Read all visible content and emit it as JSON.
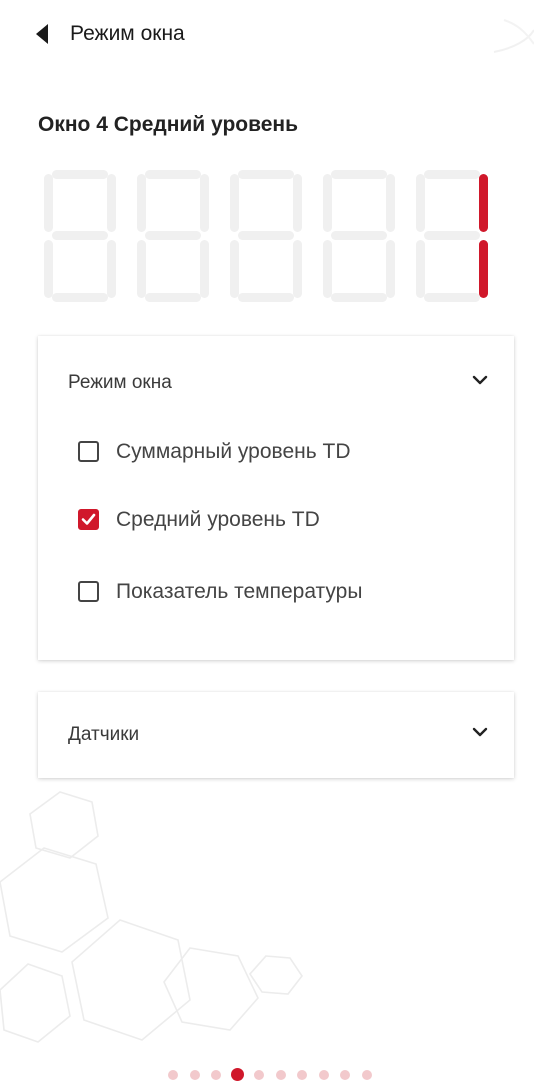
{
  "header": {
    "back_label": "Режим окна"
  },
  "window_title": "Окно 4 Средний уровень",
  "display": {
    "segment_off_color": "#f0f0f0",
    "segment_on_color": "#d0182b",
    "digits_shown": [
      "",
      "",
      "",
      "",
      "1"
    ]
  },
  "mode_panel": {
    "title": "Режим окна",
    "options": [
      {
        "label": "Суммарный уровень TD",
        "checked": false
      },
      {
        "label": "Средний уровень TD",
        "checked": true
      },
      {
        "label": "Показатель температуры",
        "checked": false
      }
    ]
  },
  "sensors_panel": {
    "title": "Датчики"
  },
  "pager": {
    "total": 10,
    "active_index": 3
  },
  "colors": {
    "accent": "#d0182b",
    "dot_inactive": "#f2c9cc"
  }
}
